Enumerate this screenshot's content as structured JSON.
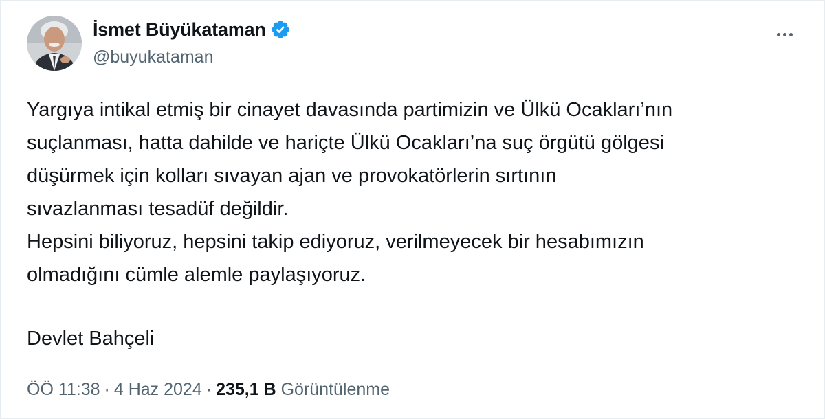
{
  "author": {
    "display_name": "İsmet Büyükataman",
    "handle": "@buyukataman",
    "verified_icon": "verified-badge-icon",
    "avatar_icon": "profile-photo"
  },
  "actions": {
    "more_icon": "more-horizontal-icon"
  },
  "tweet": {
    "lines": [
      "Yargıya intikal etmiş bir cinayet davasında partimizin ve Ülkü Ocakları’nın",
      "suçlanması, hatta dahilde ve hariçte Ülkü Ocakları’na suç örgütü gölgesi",
      "düşürmek için kolları sıvayan ajan ve provokatörlerin sırtının",
      "sıvazlanması tesadüf değildir.",
      "Hepsini biliyoruz, hepsini takip ediyoruz, verilmeyecek bir hesabımızın",
      "olmadığını cümle alemle paylaşıyoruz."
    ],
    "signature": "Devlet Bahçeli"
  },
  "meta": {
    "time": "ÖÖ 11:38",
    "separator": "·",
    "date": "4 Haz 2024",
    "views_count": "235,1 B",
    "views_label": "Görüntülenme"
  },
  "colors": {
    "text": "#0f1419",
    "secondary": "#536471",
    "verified": "#1d9bf0",
    "border": "#e6ecf0"
  }
}
